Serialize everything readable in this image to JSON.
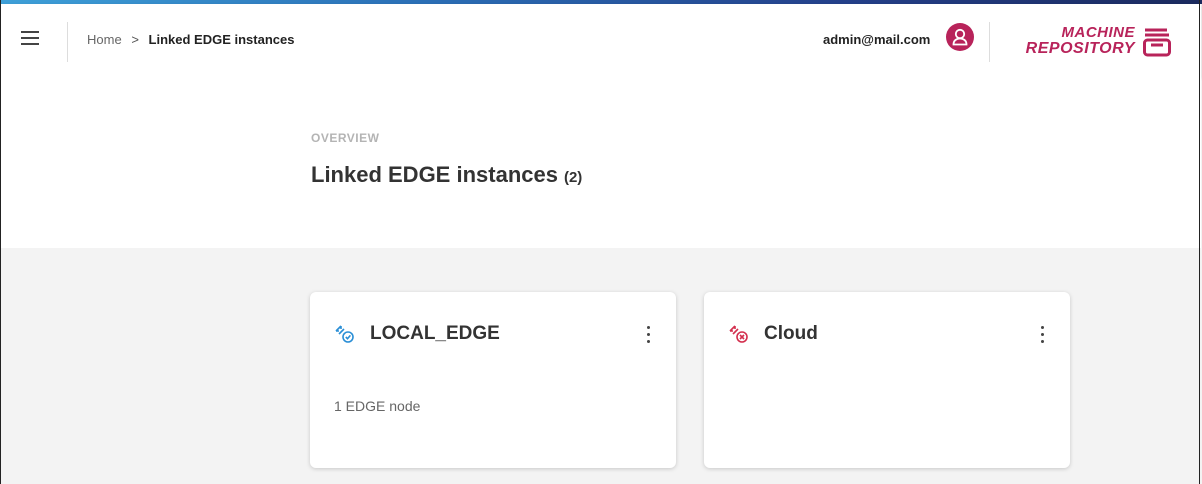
{
  "header": {
    "breadcrumb": {
      "home": "Home",
      "separator": ">",
      "current": "Linked EDGE instances"
    },
    "user_email": "admin@mail.com",
    "logo": {
      "line1": "MACHINE",
      "line2": "REPOSITORY"
    }
  },
  "hero": {
    "overline": "OVERVIEW",
    "title": "Linked EDGE instances",
    "count": "(2)"
  },
  "cards": [
    {
      "name": "LOCAL_EDGE",
      "status": "connected",
      "status_icon": "link-connected-icon",
      "info": "1 EDGE node"
    },
    {
      "name": "Cloud",
      "status": "disconnected",
      "status_icon": "link-disconnected-icon",
      "info": ""
    }
  ],
  "colors": {
    "brand": "#b8235a",
    "connected": "#2b8fd6",
    "disconnected": "#d32f4e",
    "topbar_gradient": [
      "#3ea0d8",
      "#1b2a5e"
    ]
  }
}
